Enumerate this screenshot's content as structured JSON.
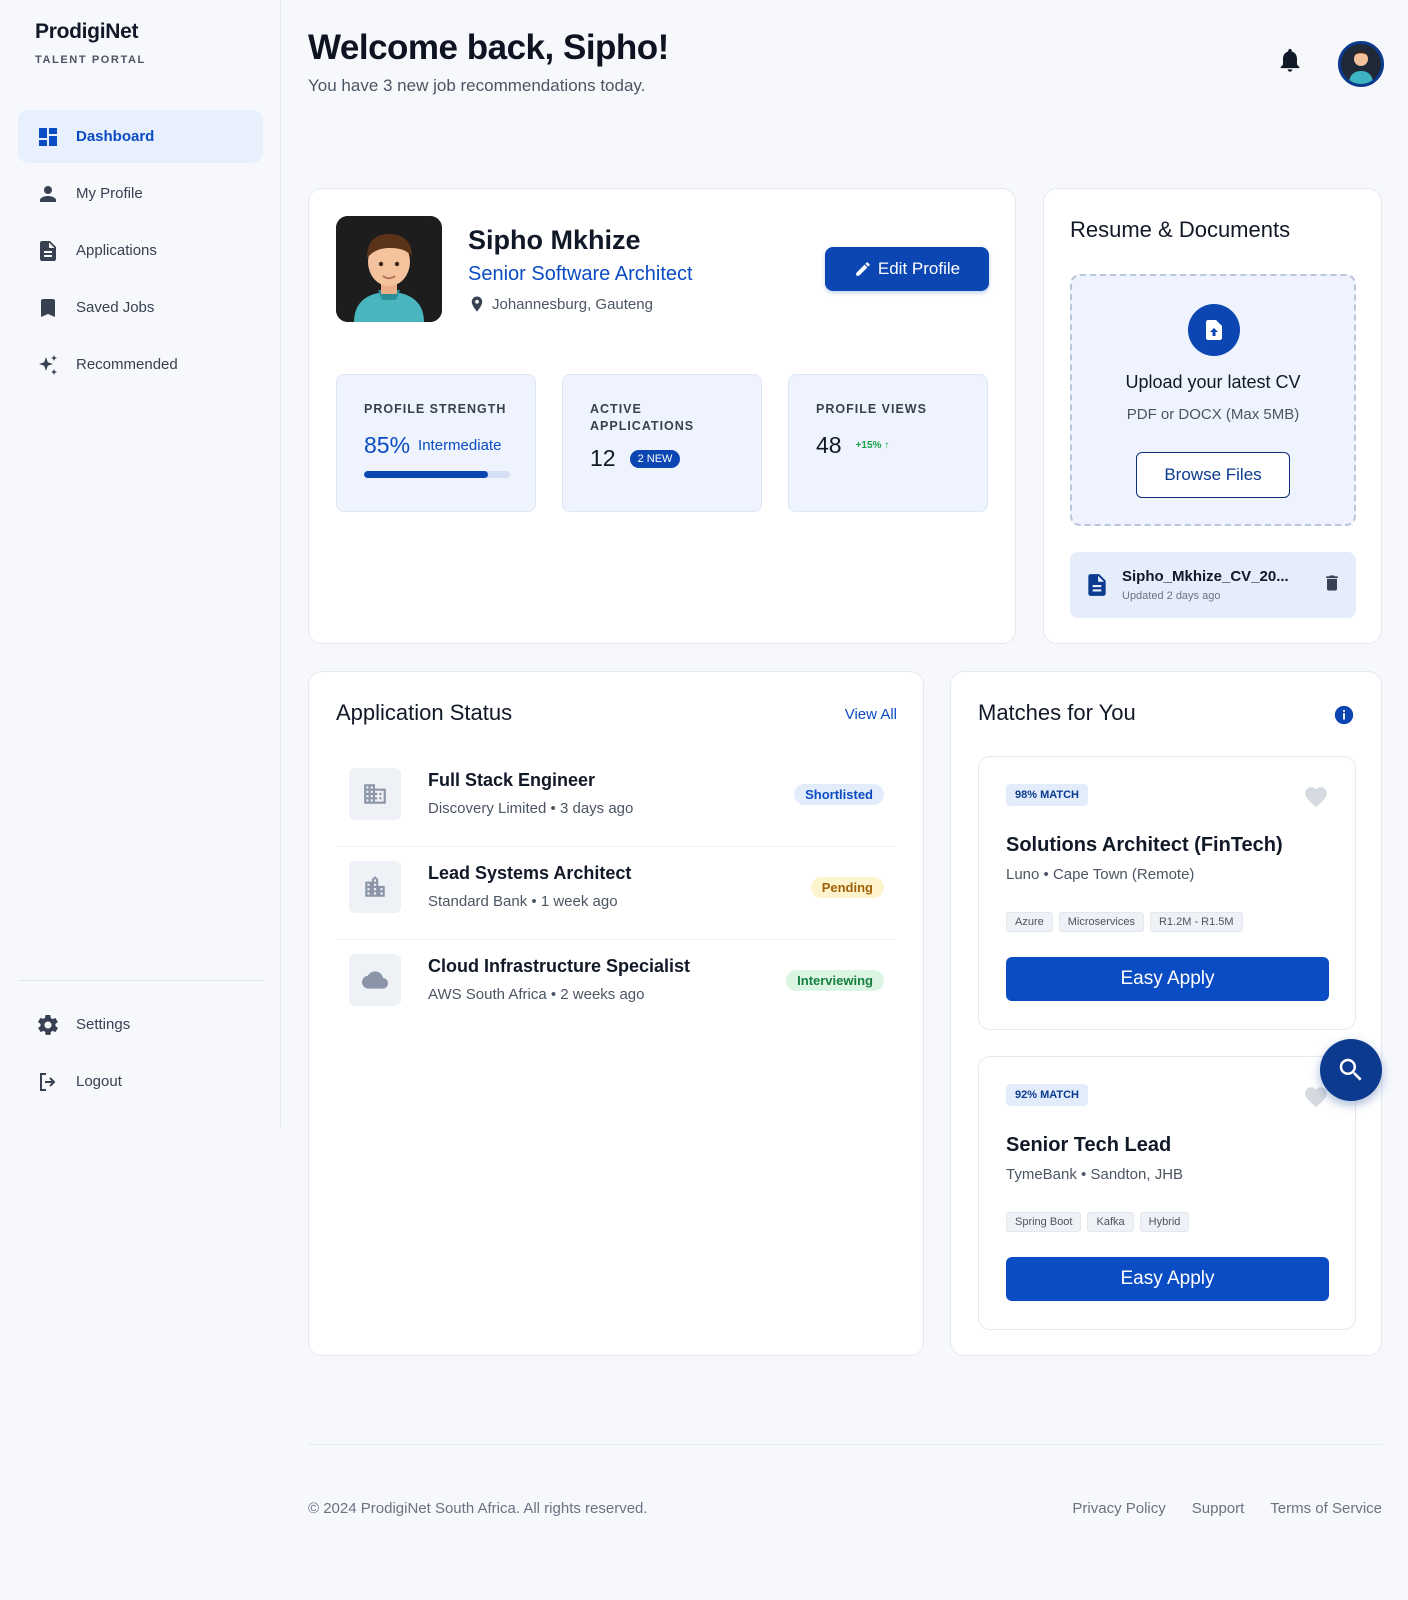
{
  "brand": {
    "name": "ProdigiNet",
    "subtitle": "TALENT PORTAL"
  },
  "sidebar": {
    "items": [
      {
        "label": "Dashboard",
        "icon": "dashboard-icon",
        "active": true
      },
      {
        "label": "My Profile",
        "icon": "person-icon"
      },
      {
        "label": "Applications",
        "icon": "document-icon"
      },
      {
        "label": "Saved Jobs",
        "icon": "bookmark-icon"
      },
      {
        "label": "Recommended",
        "icon": "sparkle-icon"
      }
    ],
    "bottom": [
      {
        "label": "Settings",
        "icon": "gear-icon"
      },
      {
        "label": "Logout",
        "icon": "logout-icon"
      }
    ]
  },
  "header": {
    "title": "Welcome back, Sipho!",
    "subtitle": "You have 3 new job recommendations today."
  },
  "profile": {
    "name": "Sipho Mkhize",
    "title": "Senior Software Architect",
    "location": "Johannesburg, Gauteng",
    "edit_label": "Edit Profile",
    "stats": {
      "strength_label": "PROFILE STRENGTH",
      "strength_value": "85%",
      "strength_fraction": 0.85,
      "strength_level": "Intermediate",
      "apps_label": "ACTIVE APPLICATIONS",
      "apps_value": "12",
      "apps_badge": "2 NEW",
      "views_label": "PROFILE VIEWS",
      "views_value": "48",
      "views_delta": "+15% ↑"
    }
  },
  "resume": {
    "title": "Resume & Documents",
    "upload_title": "Upload your latest CV",
    "upload_sub": "PDF or DOCX (Max 5MB)",
    "browse_label": "Browse Files",
    "file_name": "Sipho_Mkhize_CV_20...",
    "file_meta": "Updated 2 days ago"
  },
  "applications": {
    "title": "Application Status",
    "view_all": "View All",
    "rows": [
      {
        "title": "Full Stack Engineer",
        "company": "Discovery Limited",
        "time": "3 days ago",
        "status": "Shortlisted"
      },
      {
        "title": "Lead Systems Architect",
        "company": "Standard Bank",
        "time": "1 week ago",
        "status": "Pending"
      },
      {
        "title": "Cloud Infrastructure Specialist",
        "company": "AWS South Africa",
        "time": "2 weeks ago",
        "status": "Interviewing"
      }
    ]
  },
  "matches": {
    "title": "Matches for You",
    "items": [
      {
        "badge": "98% MATCH",
        "title": "Solutions Architect (FinTech)",
        "company": "Luno",
        "location": "Cape Town (Remote)",
        "tags": [
          "Azure",
          "Microservices",
          "R1.2M - R1.5M"
        ],
        "apply": "Easy Apply"
      },
      {
        "badge": "92% MATCH",
        "title": "Senior Tech Lead",
        "company": "TymeBank",
        "location": "Sandton, JHB",
        "tags": [
          "Spring Boot",
          "Kafka",
          "Hybrid"
        ],
        "apply": "Easy Apply"
      }
    ]
  },
  "footer": {
    "copyright": "© 2024 ProdigiNet South Africa. All rights reserved.",
    "links": [
      "Privacy Policy",
      "Support",
      "Terms of Service"
    ]
  },
  "colors": {
    "primary": "#0b46b3",
    "accent": "#0a4cc4",
    "background": "#f6f8fc"
  }
}
